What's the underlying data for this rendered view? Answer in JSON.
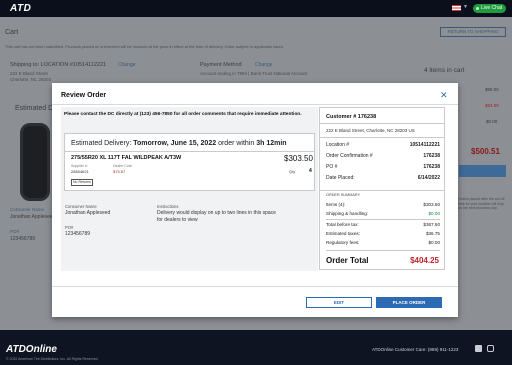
{
  "topbar": {
    "logo": "ATD",
    "live_chat": "Live Chat"
  },
  "background": {
    "page_title": "Cart",
    "return_button": "RETURN TO SHOPPING",
    "notice": "This cart has not been submitted. Products placed on a reserved will be invoiced at the price in effect at the time of delivery. Order subject to applicable taxes.",
    "shipping_label": "Shipping to: LOCATION #10514112221",
    "shipping_change": "Change",
    "shipping_address_1": "222 E Bland Street",
    "shipping_address_2": "Charlotte, NC 28203",
    "payment_label": "Payment Method",
    "payment_change": "Change",
    "payment_desc": "Account ending in 7894 | Bank Trust National Account",
    "items_count": "4 items in cart",
    "price_1": "$88.00",
    "price_2": "$64.00",
    "price_3": "$0.00",
    "total": "$500.51",
    "estimated_label": "Estimated Deli",
    "side_note": "Orders placed after the cut-off time for your location will ship on the next business day.",
    "consumer_name_label": "Consumer Name",
    "consumer_name": "Jonathan Appleseed",
    "po_label": "PO#",
    "po": "123456789"
  },
  "footer": {
    "logo": "ATDOnline",
    "copyright": "© 2022 American Tire Distributors, Inc. All Rights Reserved.",
    "customer_line": "ATDOnline Customer Care: (888) 911-1223"
  },
  "modal": {
    "title": "Review Order",
    "notice": "Please contact the DC directly at (123) 456-7850 for all order comments that require immediate attention.",
    "delivery": {
      "prefix": "Estimated Delivery:",
      "date": "Tomorrow, June 15, 2022",
      "middle": "order within",
      "time": "3h 12min"
    },
    "product": {
      "name": "275/55R20 XL 117T FAL WILDPEAK A/T3W",
      "price": "$303.50",
      "supplier_label": "Supplier #:",
      "supplier_value": "28654621",
      "dealer_cost_label": "Dealer Cost:",
      "dealer_cost_value": "$75.87",
      "qty_label": "Qty",
      "qty_value": "4",
      "badge": "No Returns"
    },
    "consumer_name_label": "Consumer Name",
    "consumer_name": "Jonathan Appleseed",
    "po_label": "PO#",
    "po_value": "123456789",
    "instructions_label": "Instructions",
    "instructions_text": "Delivery would display on up to two lines in this space for dealers to view",
    "customer": {
      "number": "Customer # 176238",
      "address": "222 E Bland Street, Charlotte, NC 28203 US",
      "rows": [
        {
          "label": "Location #",
          "value": "10514112221"
        },
        {
          "label": "Order Confirmation #",
          "value": "176238"
        },
        {
          "label": "PO #",
          "value": "176238"
        },
        {
          "label": "Date Placed:",
          "value": "6/14/2022"
        }
      ]
    },
    "summary": {
      "heading": "ORDER SUMMARY",
      "items_label": "Items (4):",
      "items_value": "$303.50",
      "shipping_label": "Shipping & handling:",
      "shipping_value": "$0.00",
      "before_tax_label": "Total before tax:",
      "before_tax_value": "$367.50",
      "est_tax_label": "Estimated taxes:",
      "est_tax_value": "$36.75",
      "reg_fee_label": "Regulatory fees:",
      "reg_fee_value": "$0.00",
      "total_label": "Order Total",
      "total_value": "$404.25"
    },
    "edit_button": "EDIT",
    "place_button": "PLACE ORDER"
  },
  "colors": {
    "accent": "#2c6bb3",
    "total_red": "#c0262d",
    "shipping_green": "#1a8a3a",
    "nav_dark": "#0b0f1c"
  }
}
